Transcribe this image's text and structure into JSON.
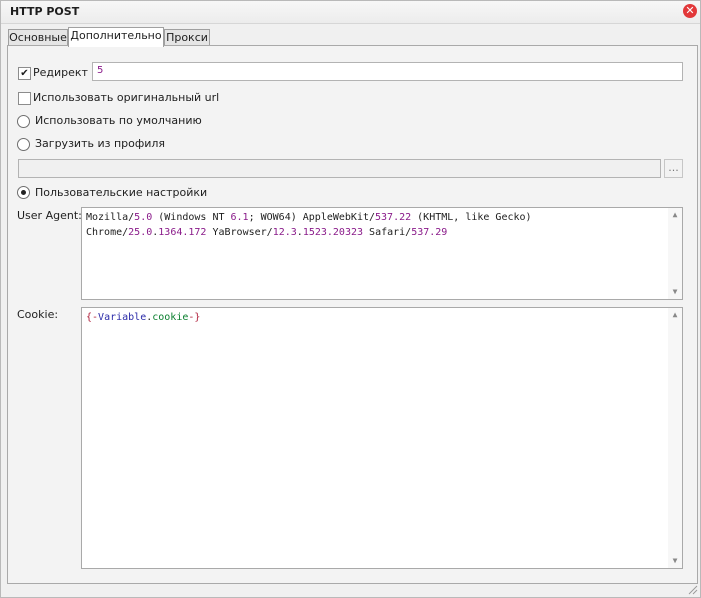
{
  "window": {
    "title": "HTTP POST"
  },
  "tabs": [
    {
      "label": "Основные"
    },
    {
      "label": "Дополнительно"
    },
    {
      "label": "Прокси"
    }
  ],
  "redirect": {
    "label": "Редирект",
    "checked": true,
    "value": "5"
  },
  "use_original_url": {
    "label": "Использовать оригинальный url",
    "checked": false
  },
  "radio_default": {
    "label": "Использовать по умолчанию",
    "selected": false
  },
  "radio_profile": {
    "label": "Загрузить из профиля",
    "selected": false,
    "path_value": "",
    "browse_label": "..."
  },
  "radio_custom": {
    "label": "Пользовательские настройки",
    "selected": true
  },
  "user_agent": {
    "label": "User Agent:",
    "value": "Mozilla/5.0 (Windows NT 6.1; WOW64) AppleWebKit/537.22 (KHTML, like Gecko) Chrome/25.0.1364.172 YaBrowser/12.3.1523.20323 Safari/537.29"
  },
  "cookie": {
    "label": "Cookie:",
    "value": "{-Variable.cookie-}"
  },
  "colors": {
    "number": "#8a1b8a",
    "macro_brace": "#b0203c",
    "variable": "#2b2ba8",
    "property": "#0a7f2e",
    "close_button": "#e2383a"
  },
  "icons": {
    "close": "close-icon",
    "checkmark": "checkmark-icon",
    "scroll_up": "chevron-up-icon",
    "scroll_down": "chevron-down-icon",
    "resize": "resize-grip-icon"
  }
}
